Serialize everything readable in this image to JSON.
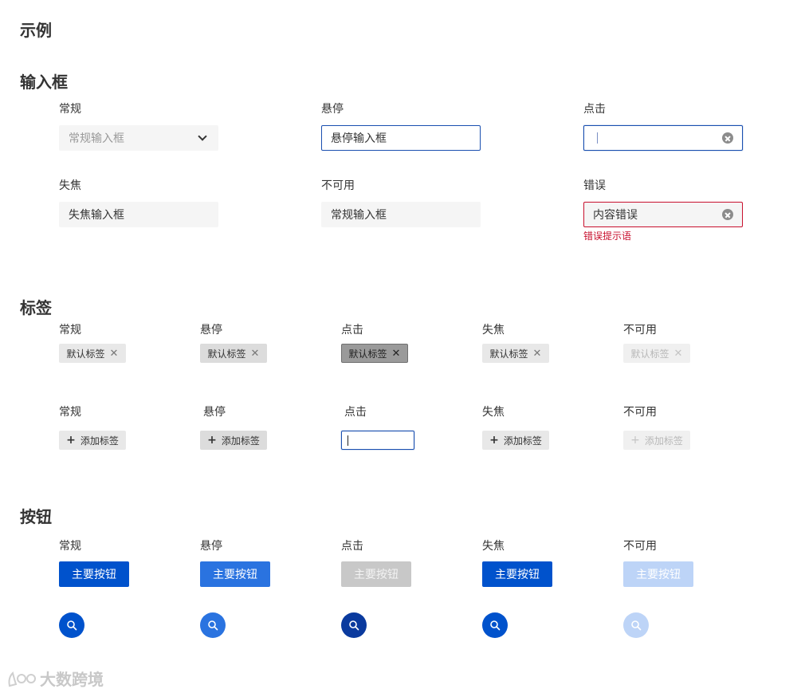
{
  "page_title": "示例",
  "input_section": {
    "title": "输入框",
    "items": [
      {
        "label": "常规",
        "placeholder": "常规输入框"
      },
      {
        "label": "悬停",
        "value": "悬停输入框"
      },
      {
        "label": "点击",
        "value": ""
      },
      {
        "label": "失焦",
        "value": "失焦输入框"
      },
      {
        "label": "不可用",
        "value": "常规输入框"
      },
      {
        "label": "错误",
        "value": "内容错误",
        "hint": "错误提示语"
      }
    ]
  },
  "tag_section": {
    "title": "标签",
    "row1": [
      {
        "label": "常规",
        "tag": "默认标签"
      },
      {
        "label": "悬停",
        "tag": "默认标签"
      },
      {
        "label": "点击",
        "tag": "默认标签"
      },
      {
        "label": "失焦",
        "tag": "默认标签"
      },
      {
        "label": "不可用",
        "tag": "默认标签"
      }
    ],
    "row2": [
      {
        "label": "常规",
        "tag": "添加标签"
      },
      {
        "label": "悬停",
        "tag": "添加标签"
      },
      {
        "label": "点击",
        "tag": ""
      },
      {
        "label": "失焦",
        "tag": "添加标签"
      },
      {
        "label": "不可用",
        "tag": "添加标签"
      }
    ]
  },
  "button_section": {
    "title": "按钮",
    "items": [
      {
        "label": "常规",
        "button": "主要按钮"
      },
      {
        "label": "悬停",
        "button": "主要按钮"
      },
      {
        "label": "点击",
        "button": "主要按钮"
      },
      {
        "label": "失焦",
        "button": "主要按钮"
      },
      {
        "label": "不可用",
        "button": "主要按钮"
      }
    ],
    "icon_buttons": [
      "search-icon",
      "search-icon",
      "search-icon",
      "search-icon",
      "search-icon"
    ]
  },
  "watermark": "大数跨境",
  "colors": {
    "primary": "#0052cc",
    "primary_hover": "#2a73e0",
    "primary_active": "#0a3a9e",
    "primary_disabled": "#bdd4f7",
    "focus_border": "#1a4fb0",
    "error": "#c8102e",
    "input_bg": "#f5f5f5",
    "tag_bg": "#e8e8e8"
  }
}
